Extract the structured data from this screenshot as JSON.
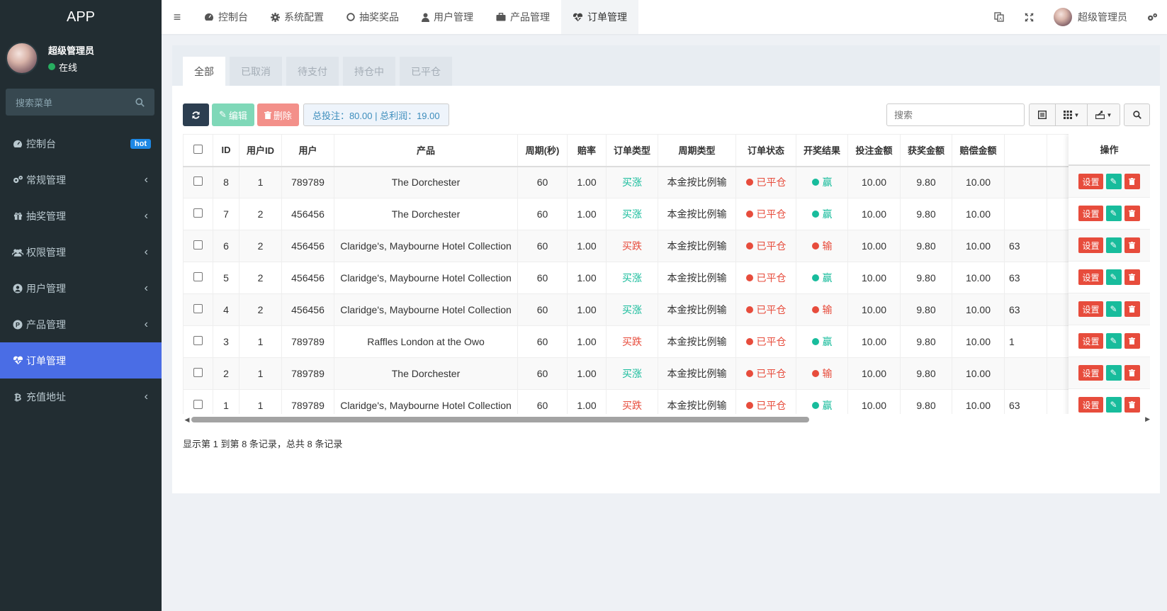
{
  "sidebar": {
    "brand": "APP",
    "user": {
      "name": "超级管理员",
      "status": "在线",
      "status_color": "#27ae60"
    },
    "search_placeholder": "搜索菜单",
    "items": [
      {
        "label": "控制台",
        "icon": "dashboard-icon",
        "badge": "hot"
      },
      {
        "label": "常规管理",
        "icon": "cogs-icon"
      },
      {
        "label": "抽奖管理",
        "icon": "gift-icon"
      },
      {
        "label": "权限管理",
        "icon": "group-icon"
      },
      {
        "label": "用户管理",
        "icon": "user-circle-icon"
      },
      {
        "label": "产品管理",
        "icon": "product-icon"
      },
      {
        "label": "订单管理",
        "icon": "heartbeat-icon",
        "active": true
      },
      {
        "label": "充值地址",
        "icon": "bitcoin-icon"
      }
    ]
  },
  "topbar": {
    "tabs": [
      {
        "label": "控制台",
        "icon": "dashboard-icon"
      },
      {
        "label": "系统配置",
        "icon": "gear-icon"
      },
      {
        "label": "抽奖奖品",
        "icon": "circle-icon"
      },
      {
        "label": "用户管理",
        "icon": "user-icon"
      },
      {
        "label": "产品管理",
        "icon": "briefcase-icon"
      },
      {
        "label": "订单管理",
        "icon": "heartbeat-icon",
        "active": true
      }
    ],
    "user_name": "超级管理员"
  },
  "page": {
    "tabs": [
      "全部",
      "已取消",
      "待支付",
      "持仓中",
      "已平仓"
    ],
    "toolbar": {
      "edit_label": "编辑",
      "delete_label": "删除",
      "summary": "总投注：80.00 | 总利润：19.00"
    },
    "search_placeholder": "搜索",
    "columns": [
      "ID",
      "用户ID",
      "用户",
      "产品",
      "周期(秒)",
      "赔率",
      "订单类型",
      "周期类型",
      "订单状态",
      "开奖结果",
      "投注金额",
      "获奖金额",
      "赔偿金额",
      "",
      "操作"
    ],
    "rows": [
      {
        "id": "8",
        "uid": "1",
        "user": "789789",
        "product": "The Dorchester",
        "period": "60",
        "odds": "1.00",
        "type": "买涨",
        "type_kind": "up",
        "period_type": "本金按比例输",
        "status": "已平仓",
        "result": "赢",
        "result_kind": "win",
        "bet": "10.00",
        "prize": "9.80",
        "comp": "10.00",
        "extra": ""
      },
      {
        "id": "7",
        "uid": "2",
        "user": "456456",
        "product": "The Dorchester",
        "period": "60",
        "odds": "1.00",
        "type": "买涨",
        "type_kind": "up",
        "period_type": "本金按比例输",
        "status": "已平仓",
        "result": "赢",
        "result_kind": "win",
        "bet": "10.00",
        "prize": "9.80",
        "comp": "10.00",
        "extra": ""
      },
      {
        "id": "6",
        "uid": "2",
        "user": "456456",
        "product": "Claridge's, Maybourne Hotel Collection",
        "period": "60",
        "odds": "1.00",
        "type": "买跌",
        "type_kind": "down",
        "period_type": "本金按比例输",
        "status": "已平仓",
        "result": "输",
        "result_kind": "lose",
        "bet": "10.00",
        "prize": "9.80",
        "comp": "10.00",
        "extra": "63"
      },
      {
        "id": "5",
        "uid": "2",
        "user": "456456",
        "product": "Claridge's, Maybourne Hotel Collection",
        "period": "60",
        "odds": "1.00",
        "type": "买涨",
        "type_kind": "up",
        "period_type": "本金按比例输",
        "status": "已平仓",
        "result": "赢",
        "result_kind": "win",
        "bet": "10.00",
        "prize": "9.80",
        "comp": "10.00",
        "extra": "63"
      },
      {
        "id": "4",
        "uid": "2",
        "user": "456456",
        "product": "Claridge's, Maybourne Hotel Collection",
        "period": "60",
        "odds": "1.00",
        "type": "买涨",
        "type_kind": "up",
        "period_type": "本金按比例输",
        "status": "已平仓",
        "result": "输",
        "result_kind": "lose",
        "bet": "10.00",
        "prize": "9.80",
        "comp": "10.00",
        "extra": "63"
      },
      {
        "id": "3",
        "uid": "1",
        "user": "789789",
        "product": "Raffles London at the Owo",
        "period": "60",
        "odds": "1.00",
        "type": "买跌",
        "type_kind": "down",
        "period_type": "本金按比例输",
        "status": "已平仓",
        "result": "赢",
        "result_kind": "win",
        "bet": "10.00",
        "prize": "9.80",
        "comp": "10.00",
        "extra": "1"
      },
      {
        "id": "2",
        "uid": "1",
        "user": "789789",
        "product": "The Dorchester",
        "period": "60",
        "odds": "1.00",
        "type": "买涨",
        "type_kind": "up",
        "period_type": "本金按比例输",
        "status": "已平仓",
        "result": "输",
        "result_kind": "lose",
        "bet": "10.00",
        "prize": "9.80",
        "comp": "10.00",
        "extra": ""
      },
      {
        "id": "1",
        "uid": "1",
        "user": "789789",
        "product": "Claridge's, Maybourne Hotel Collection",
        "period": "60",
        "odds": "1.00",
        "type": "买跌",
        "type_kind": "down",
        "period_type": "本金按比例输",
        "status": "已平仓",
        "result": "赢",
        "result_kind": "win",
        "bet": "10.00",
        "prize": "9.80",
        "comp": "10.00",
        "extra": "63"
      }
    ],
    "ops": {
      "set_label": "设置"
    },
    "footer": "显示第 1 到第 8 条记录，总共 8 条记录"
  },
  "colors": {
    "sidebar_bg": "#222d32",
    "active_menu": "#4a6de5",
    "up": "#18bc9c",
    "down": "#e74c3c",
    "win_dot": "#18bc9c",
    "lose_dot": "#e74c3c"
  }
}
